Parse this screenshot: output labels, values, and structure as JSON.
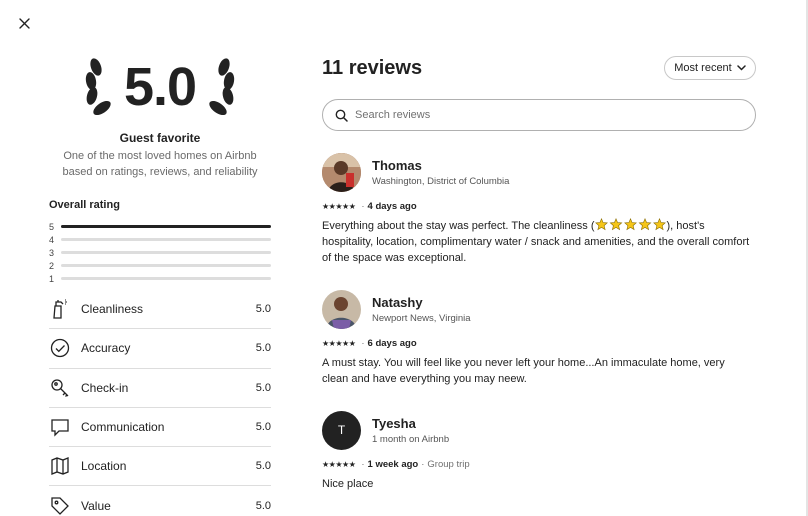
{
  "close": {
    "icon": "close-icon"
  },
  "summary": {
    "score": "5.0",
    "title": "Guest favorite",
    "subtitle": "One of the most loved homes on Airbnb based on ratings, reviews, and reliability"
  },
  "overall": {
    "title": "Overall rating",
    "distribution": [
      {
        "stars": "5",
        "fraction": 1.0
      },
      {
        "stars": "4",
        "fraction": 0
      },
      {
        "stars": "3",
        "fraction": 0
      },
      {
        "stars": "2",
        "fraction": 0
      },
      {
        "stars": "1",
        "fraction": 0
      }
    ]
  },
  "categories": [
    {
      "label": "Cleanliness",
      "value": "5.0",
      "icon": "spray-bottle-icon"
    },
    {
      "label": "Accuracy",
      "value": "5.0",
      "icon": "check-circle-icon"
    },
    {
      "label": "Check-in",
      "value": "5.0",
      "icon": "key-icon"
    },
    {
      "label": "Communication",
      "value": "5.0",
      "icon": "chat-bubble-icon"
    },
    {
      "label": "Location",
      "value": "5.0",
      "icon": "map-icon"
    },
    {
      "label": "Value",
      "value": "5.0",
      "icon": "price-tag-icon"
    }
  ],
  "reviews_header": {
    "count_label": "11 reviews",
    "sort_label": "Most recent",
    "search_placeholder": "Search reviews"
  },
  "reviews": [
    {
      "name": "Thomas",
      "subtitle": "Washington, District of Columbia",
      "stars": "★★★★★",
      "when": "4 days ago",
      "extra": "",
      "text_before": "Everything about the stay was perfect. The cleanliness (",
      "text_after": "), host's hospitality, location, complimentary water / snack and amenities, and the overall comfort of the space was exceptional.",
      "avatar": "photo"
    },
    {
      "name": "Natashy",
      "subtitle": "Newport News, Virginia",
      "stars": "★★★★★",
      "when": "6 days ago",
      "extra": "",
      "text": "A must stay. You will feel like you never left your home...An immaculate home, very clean and have everything you may neew.",
      "avatar": "photo"
    },
    {
      "name": "Tyesha",
      "subtitle": "1 month on Airbnb",
      "stars": "★★★★★",
      "when": "1 week ago",
      "extra": "Group trip",
      "text": "Nice place",
      "avatar_initial": "T"
    }
  ],
  "colors": {
    "text": "#222222",
    "muted": "#6a6a6a",
    "divider": "#dddddd",
    "emoji_star": "#f5c518"
  }
}
